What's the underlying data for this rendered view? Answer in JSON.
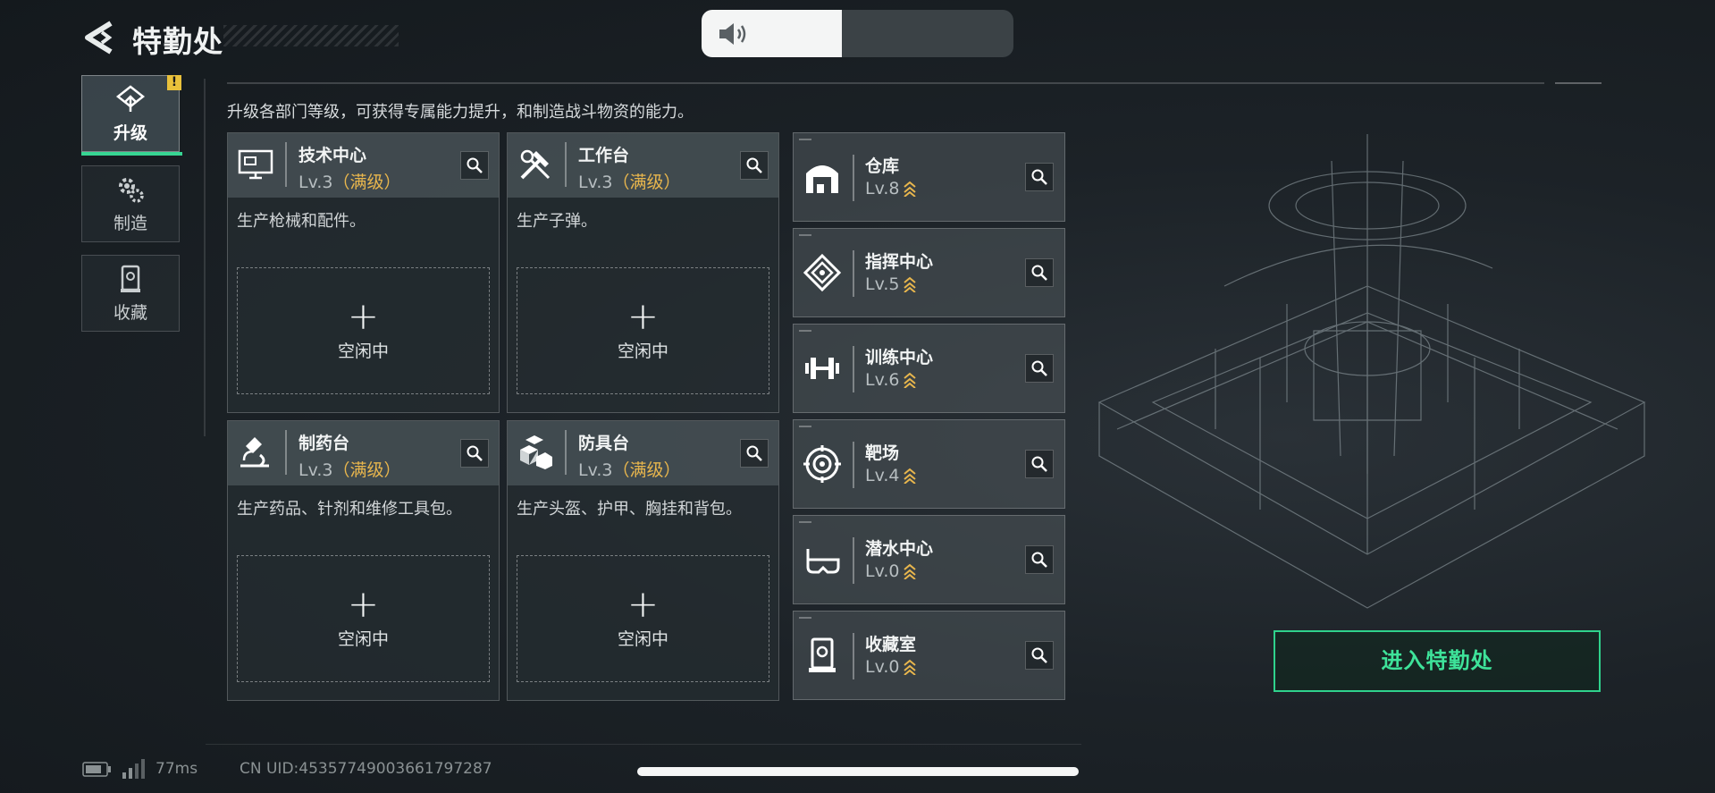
{
  "header": {
    "title": "特勤处",
    "subtitle": "升级各部门等级，可获得专属能力提升，和制造战斗物资的能力。",
    "volume_level": 0.45
  },
  "sidebar": {
    "tabs": [
      {
        "label": "升级",
        "icon": "upgrade-icon",
        "active": true,
        "badge": "!"
      },
      {
        "label": "制造",
        "icon": "gears-icon",
        "active": false
      },
      {
        "label": "收藏",
        "icon": "collection-icon",
        "active": false
      }
    ]
  },
  "workshops": [
    {
      "name": "技术中心",
      "level": "Lv.3",
      "max_tag": "（满级）",
      "description": "生产枪械和配件。",
      "slot_text": "空闲中",
      "slot_plus": "+",
      "icon": "computer-icon"
    },
    {
      "name": "工作台",
      "level": "Lv.3",
      "max_tag": "（满级）",
      "description": "生产子弹。",
      "slot_text": "空闲中",
      "slot_plus": "+",
      "icon": "tools-icon"
    },
    {
      "name": "制药台",
      "level": "Lv.3",
      "max_tag": "（满级）",
      "description": "生产药品、针剂和维修工具包。",
      "slot_text": "空闲中",
      "slot_plus": "+",
      "icon": "microscope-icon"
    },
    {
      "name": "防具台",
      "level": "Lv.3",
      "max_tag": "（满级）",
      "description": "生产头盔、护甲、胸挂和背包。",
      "slot_text": "空闲中",
      "slot_plus": "+",
      "icon": "armor-icon"
    }
  ],
  "facilities": [
    {
      "name": "仓库",
      "level": "Lv.8",
      "icon": "warehouse-icon"
    },
    {
      "name": "指挥中心",
      "level": "Lv.5",
      "icon": "command-icon"
    },
    {
      "name": "训练中心",
      "level": "Lv.6",
      "icon": "dumbbell-icon"
    },
    {
      "name": "靶场",
      "level": "Lv.4",
      "icon": "target-icon"
    },
    {
      "name": "潜水中心",
      "level": "Lv.0",
      "icon": "diving-mask-icon"
    },
    {
      "name": "收藏室",
      "level": "Lv.0",
      "icon": "collection-room-icon"
    }
  ],
  "enter_button": "进入特勤处",
  "status": {
    "ping": "77ms",
    "uid": "CN UID:4535774900366179728​7"
  },
  "colors": {
    "accent_green": "#37d593",
    "max_level_gold": "#e8b64d"
  }
}
